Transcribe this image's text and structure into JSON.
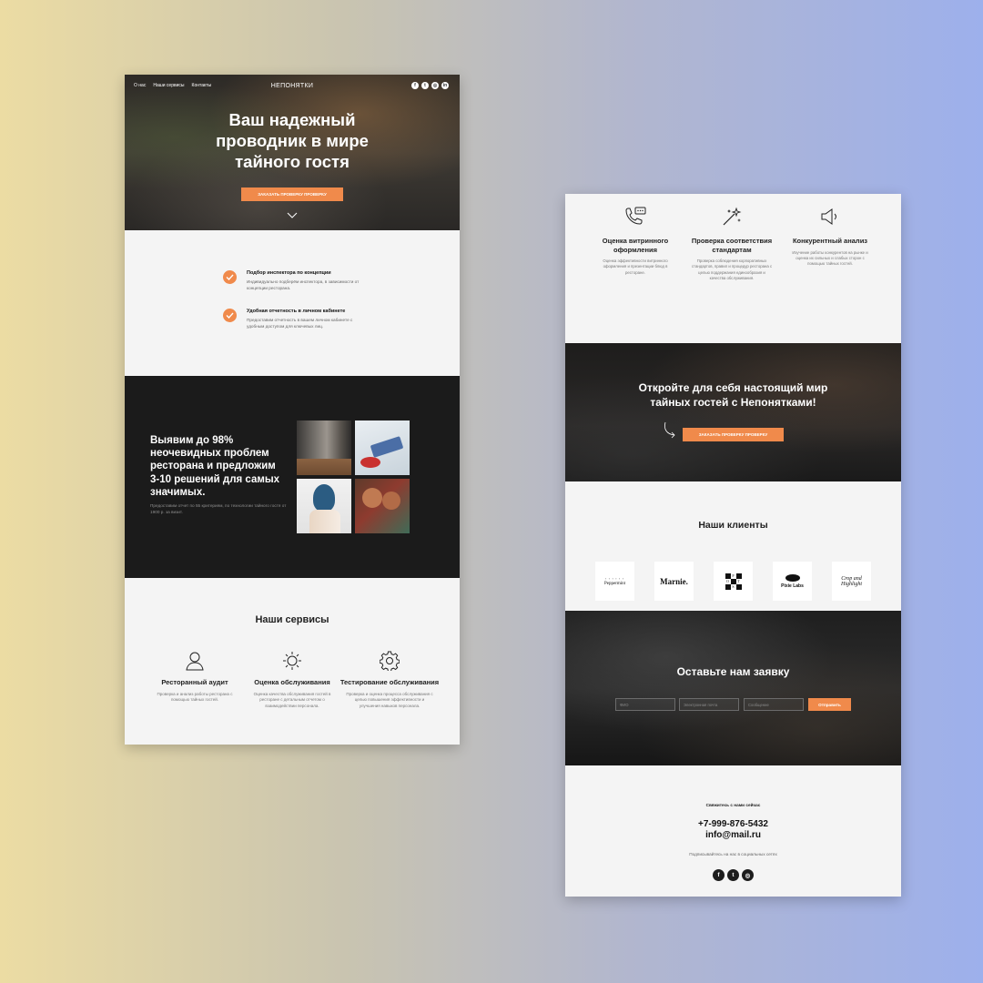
{
  "left_page": {
    "nav": {
      "items": [
        "О нас",
        "Наши сервисы",
        "Контакты"
      ],
      "brand": "НЕПОНЯТКИ"
    },
    "social_icons": [
      "facebook-icon",
      "twitter-icon",
      "instagram-icon",
      "linkedin-icon"
    ],
    "hero": {
      "title_lines": [
        "Ваш надежный",
        "проводник в мире",
        "тайного гостя"
      ],
      "button": "ЗАКАЗАТЬ ПРОВЕРКУ ПРОВЕРКУ"
    },
    "features": [
      {
        "title": "Подбор инспектора по концепции",
        "text": "Индивидуально подберём инспектора, в зависимости от концепции ресторана."
      },
      {
        "title": "Удобная отчетность в личном кабинете",
        "text": "Предоставим отчетность в вашем личном кабинете с удобным доступом для ключевых лиц."
      }
    ],
    "dark_block": {
      "title_lines": [
        "Выявим до 98%",
        "неочевидных проблем",
        "ресторана и предложим",
        "3-10 решений для самых",
        "значимых."
      ],
      "text": "Предоставим отчет по 55 критериям, по технологии тайного гостя от 1900 р. за визит."
    },
    "services": {
      "title": "Наши сервисы",
      "items": [
        {
          "icon": "user-icon",
          "title": "Ресторанный аудит",
          "text": "Проверка и анализ работы ресторана с помощью тайных гостей."
        },
        {
          "icon": "sun-icon",
          "title": "Оценка обслуживания",
          "text": "Оценка качества обслуживания гостей в ресторане с детальным отчетом о взаимодействии персонала."
        },
        {
          "icon": "gear-icon",
          "title": "Тестирование обслуживания",
          "text": "Проверка и оценка процесса обслуживания с целью повышения эффективности и улучшения навыков персонала."
        }
      ]
    }
  },
  "right_page": {
    "services": [
      {
        "icon": "phone-chat-icon",
        "title": "Оценка витринного оформления",
        "text": "Оценка эффективности витринного оформления и презентации блюд в ресторане."
      },
      {
        "icon": "magic-wand-icon",
        "title": "Проверка соответствия стандартам",
        "text": "Проверка соблюдения корпоративных стандартов, правил и процедур ресторана с целью поддержания единообразия и качества обслуживания."
      },
      {
        "icon": "megaphone-icon",
        "title": "Конкурентный анализ",
        "text": "Изучение работы конкурентов на рынке и оценка их сильных и слабых сторон с помощью тайных гостей."
      }
    ],
    "cta": {
      "title_lines": [
        "Откройте для себя настоящий мир",
        "тайных гостей с Непонятками!"
      ],
      "button": "ЗАКАЗАТЬ ПРОВЕРКУ ПРОВЕРКУ"
    },
    "clients": {
      "title": "Наши клиенты",
      "logos": {
        "peppermint": "Peppermint",
        "marnie": "Marnie.",
        "grid_letters": [
          "P",
          "O",
          "T",
          "S"
        ],
        "pixie": "Pixie Labs",
        "crop_lines": [
          "Crop and",
          "Highlight"
        ]
      }
    },
    "form": {
      "title": "Оставьте нам заявку",
      "placeholders": [
        "ФИО",
        "Электронная почта",
        "Сообщение"
      ],
      "button": "Отправить"
    },
    "footer": {
      "contact_title": "Свяжитесь с нами сейчас",
      "phone": "+7-999-876-5432",
      "email": "info@mail.ru",
      "subscribe": "Подписывайтесь на нас в социальных сетях",
      "social_icons": [
        "facebook-icon",
        "twitter-icon",
        "instagram-icon"
      ]
    }
  },
  "colors": {
    "accent": "#f08a4b",
    "dark": "#1b1b1b",
    "light": "#f4f4f4"
  }
}
